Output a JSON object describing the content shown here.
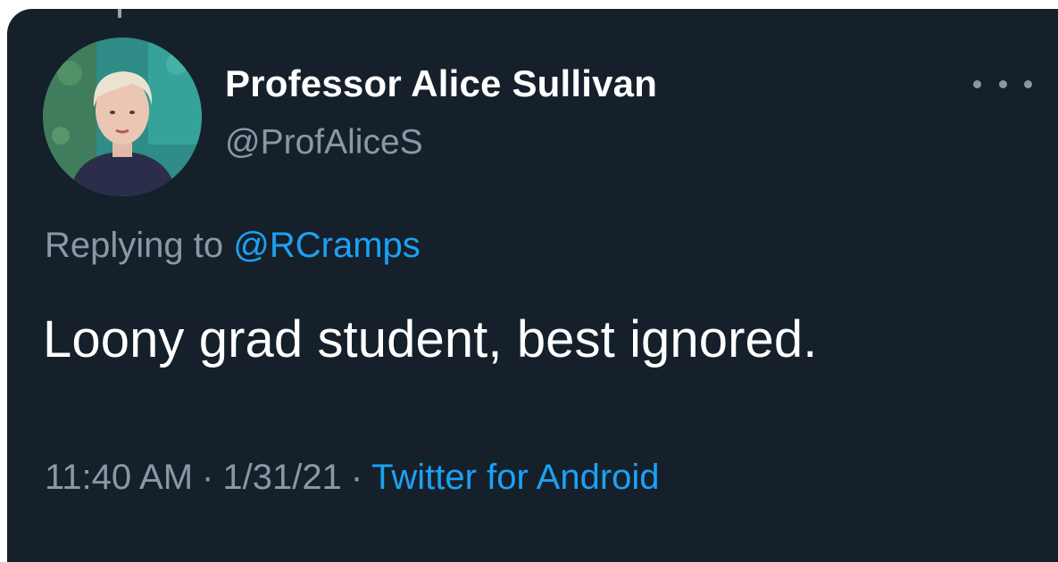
{
  "tweet": {
    "author_name": "Professor Alice Sullivan",
    "author_handle": "@ProfAliceS",
    "replying_prefix": "Replying to",
    "replying_to": "@RCramps",
    "text": "Loony grad student, best ignored.",
    "time": "11:40 AM",
    "date": "1/31/21",
    "separator": "·",
    "source": "Twitter for Android"
  },
  "icons": {
    "more": "more-options-icon",
    "avatar": "profile-avatar"
  },
  "colors": {
    "background": "#15202b",
    "primary_text": "#ffffff",
    "secondary_text": "#8899a6",
    "link": "#1da1f2"
  }
}
